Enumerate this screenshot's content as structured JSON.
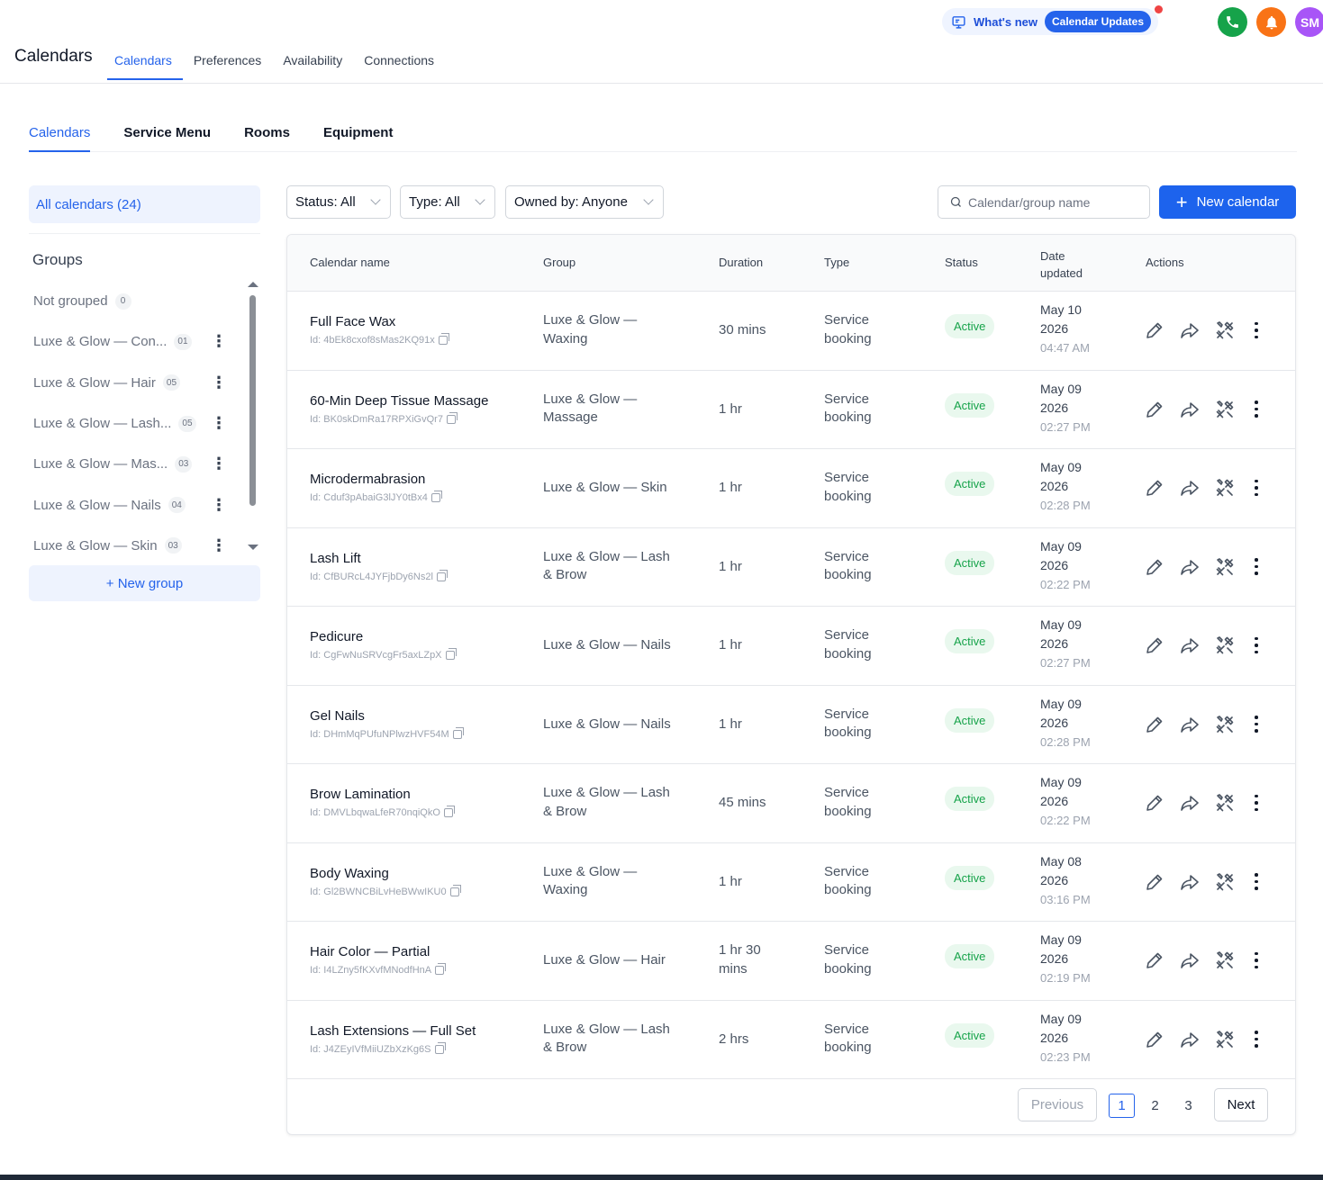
{
  "app": {
    "title": "Calendars",
    "top_tabs": [
      "Calendars",
      "Preferences",
      "Availability",
      "Connections"
    ],
    "whats_new_label": "What's new",
    "whats_new_badge": "Calendar Updates",
    "avatar_initials": "SM",
    "colors": {
      "accent": "#2563eb",
      "phone": "#16a34a",
      "bell": "#f97316",
      "avatar": "#a855f7",
      "active_status": "#16a34a"
    }
  },
  "sub_tabs": [
    "Calendars",
    "Service Menu",
    "Rooms",
    "Equipment"
  ],
  "sidebar": {
    "all_calendars": "All calendars (24)",
    "groups_title": "Groups",
    "groups": [
      {
        "name": "Not grouped",
        "count": "0",
        "menu": false
      },
      {
        "name": "Luxe & Glow — Con...",
        "count": "01",
        "menu": true
      },
      {
        "name": "Luxe & Glow — Hair",
        "count": "05",
        "menu": true
      },
      {
        "name": "Luxe & Glow — Lash...",
        "count": "05",
        "menu": true
      },
      {
        "name": "Luxe & Glow — Mas...",
        "count": "03",
        "menu": true
      },
      {
        "name": "Luxe & Glow — Nails",
        "count": "04",
        "menu": true
      },
      {
        "name": "Luxe & Glow — Skin",
        "count": "03",
        "menu": true
      }
    ],
    "new_group": "+ New group"
  },
  "filters": {
    "status": "Status: All",
    "type": "Type: All",
    "owned_by": "Owned by: Anyone",
    "search_placeholder": "Calendar/group name",
    "new_calendar": "New calendar"
  },
  "table": {
    "headers": {
      "name": "Calendar name",
      "group": "Group",
      "duration": "Duration",
      "type": "Type",
      "status": "Status",
      "date_l1": "Date",
      "date_l2": "updated",
      "actions": "Actions"
    },
    "rows": [
      {
        "name": "Full Face Wax",
        "id": "Id: 4bEk8cxof8sMas2KQ91x",
        "group_l1": "Luxe & Glow —",
        "group_l2": "Waxing",
        "duration_l1": "30 mins",
        "duration_l2": "",
        "type_l1": "Service",
        "type_l2": "booking",
        "status": "Active",
        "date_l1": "May 10",
        "date_l2": "2026",
        "time": "04:47 AM"
      },
      {
        "name": "60-Min Deep Tissue Massage",
        "id": "Id: BK0skDmRa17RPXiGvQr7",
        "group_l1": "Luxe & Glow —",
        "group_l2": "Massage",
        "duration_l1": "1 hr",
        "duration_l2": "",
        "type_l1": "Service",
        "type_l2": "booking",
        "status": "Active",
        "date_l1": "May 09",
        "date_l2": "2026",
        "time": "02:27 PM"
      },
      {
        "name": "Microdermabrasion",
        "id": "Id: Cduf3pAbaiG3lJY0tBx4",
        "group_l1": "Luxe & Glow — Skin",
        "group_l2": "",
        "duration_l1": "1 hr",
        "duration_l2": "",
        "type_l1": "Service",
        "type_l2": "booking",
        "status": "Active",
        "date_l1": "May 09",
        "date_l2": "2026",
        "time": "02:28 PM"
      },
      {
        "name": "Lash Lift",
        "id": "Id: CfBURcL4JYFjbDy6Ns2l",
        "group_l1": "Luxe & Glow — Lash",
        "group_l2": "& Brow",
        "duration_l1": "1 hr",
        "duration_l2": "",
        "type_l1": "Service",
        "type_l2": "booking",
        "status": "Active",
        "date_l1": "May 09",
        "date_l2": "2026",
        "time": "02:22 PM"
      },
      {
        "name": "Pedicure",
        "id": "Id: CgFwNuSRVcgFr5axLZpX",
        "group_l1": "Luxe & Glow — Nails",
        "group_l2": "",
        "duration_l1": "1 hr",
        "duration_l2": "",
        "type_l1": "Service",
        "type_l2": "booking",
        "status": "Active",
        "date_l1": "May 09",
        "date_l2": "2026",
        "time": "02:27 PM"
      },
      {
        "name": "Gel Nails",
        "id": "Id: DHmMqPUfuNPlwzHVF54M",
        "group_l1": "Luxe & Glow — Nails",
        "group_l2": "",
        "duration_l1": "1 hr",
        "duration_l2": "",
        "type_l1": "Service",
        "type_l2": "booking",
        "status": "Active",
        "date_l1": "May 09",
        "date_l2": "2026",
        "time": "02:28 PM"
      },
      {
        "name": "Brow Lamination",
        "id": "Id: DMVLbqwaLfeR70nqiQkO",
        "group_l1": "Luxe & Glow — Lash",
        "group_l2": "& Brow",
        "duration_l1": "45 mins",
        "duration_l2": "",
        "type_l1": "Service",
        "type_l2": "booking",
        "status": "Active",
        "date_l1": "May 09",
        "date_l2": "2026",
        "time": "02:22 PM"
      },
      {
        "name": "Body Waxing",
        "id": "Id: Gl2BWNCBiLvHeBWwIKU0",
        "group_l1": "Luxe & Glow —",
        "group_l2": "Waxing",
        "duration_l1": "1 hr",
        "duration_l2": "",
        "type_l1": "Service",
        "type_l2": "booking",
        "status": "Active",
        "date_l1": "May 08",
        "date_l2": "2026",
        "time": "03:16 PM"
      },
      {
        "name": "Hair Color — Partial",
        "id": "Id: I4LZny5fKXvfMNodfHnA",
        "group_l1": "Luxe & Glow — Hair",
        "group_l2": "",
        "duration_l1": "1 hr 30",
        "duration_l2": "mins",
        "type_l1": "Service",
        "type_l2": "booking",
        "status": "Active",
        "date_l1": "May 09",
        "date_l2": "2026",
        "time": "02:19 PM"
      },
      {
        "name": "Lash Extensions — Full Set",
        "id": "Id: J4ZEyIVfMiiUZbXzKg6S",
        "group_l1": "Luxe & Glow — Lash",
        "group_l2": "& Brow",
        "duration_l1": "2 hrs",
        "duration_l2": "",
        "type_l1": "Service",
        "type_l2": "booking",
        "status": "Active",
        "date_l1": "May 09",
        "date_l2": "2026",
        "time": "02:23 PM"
      }
    ]
  },
  "pagination": {
    "previous": "Previous",
    "pages": [
      "1",
      "2",
      "3"
    ],
    "current": "1",
    "next": "Next"
  }
}
